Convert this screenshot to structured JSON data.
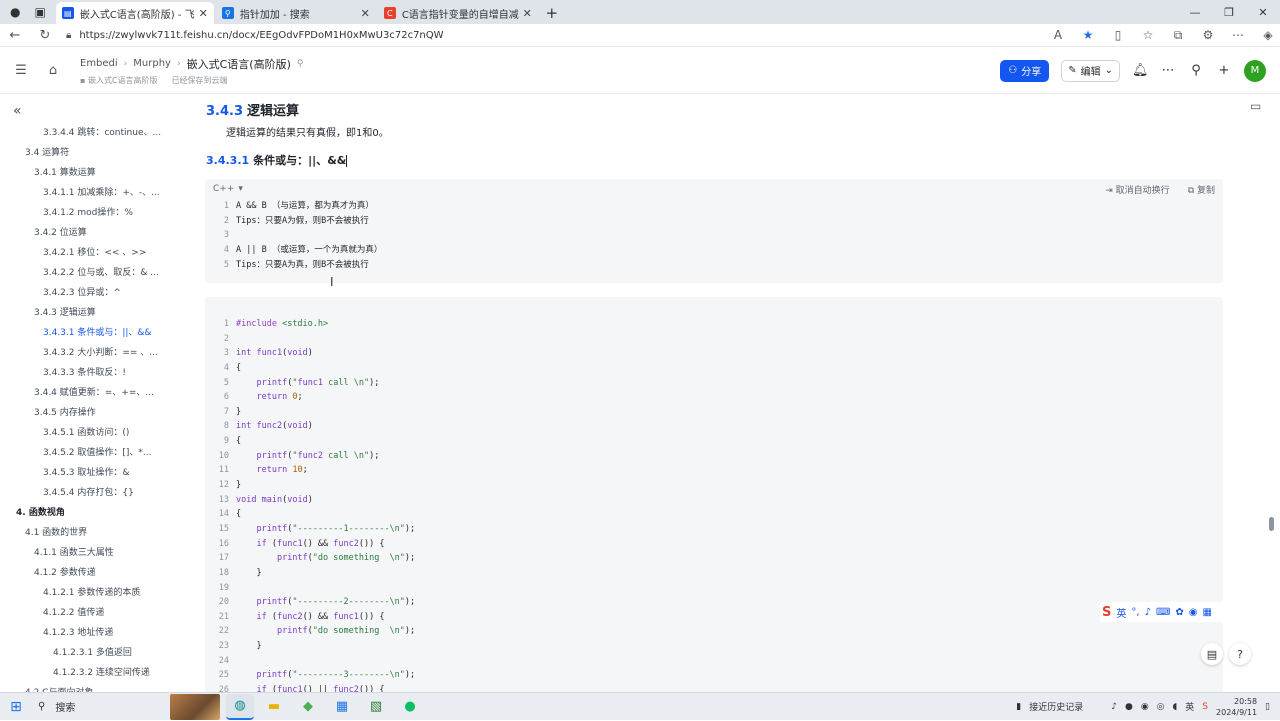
{
  "browser": {
    "tabs": [
      {
        "title": "嵌入式C语言(高阶版) - 飞书云文档",
        "active": true,
        "favicon_color": "#1456f0"
      },
      {
        "title": "指针加加 - 搜索",
        "active": false,
        "favicon_color": "#1a73e8"
      },
      {
        "title": "C语言指针变量的自增自减分析",
        "active": false,
        "favicon_color": "#e8412c"
      }
    ],
    "url": "https://zwylwvk711t.feishu.cn/docx/EEgOdvFPDoM1H0xMwU3c72c7nQW"
  },
  "header": {
    "breadcrumbs": [
      "Embedi",
      "Murphy",
      "嵌入式C语言(高阶版)"
    ],
    "sub_location": "嵌入式C语言高阶版",
    "save_status": "已经保存到云端",
    "share_label": "分享",
    "edit_label": "编辑",
    "avatar_letter": "M"
  },
  "outline": [
    {
      "label": "3.3.4.4 跳转：continue、...",
      "level": 4
    },
    {
      "label": "3.4 运算符",
      "level": 2
    },
    {
      "label": "3.4.1 算数运算",
      "level": 3
    },
    {
      "label": "3.4.1.1 加减乘除：+、-、...",
      "level": 4
    },
    {
      "label": "3.4.1.2 mod操作：%",
      "level": 4
    },
    {
      "label": "3.4.2 位运算",
      "level": 3
    },
    {
      "label": "3.4.2.1 移位：<< 、>>",
      "level": 4
    },
    {
      "label": "3.4.2.2 位与或、取反：& ...",
      "level": 4
    },
    {
      "label": "3.4.2.3 位异或：^",
      "level": 4
    },
    {
      "label": "3.4.3 逻辑运算",
      "level": 3
    },
    {
      "label": "3.4.3.1 条件或与：||、&&",
      "level": 4,
      "active": true
    },
    {
      "label": "3.4.3.2 大小判断：== 、...",
      "level": 4
    },
    {
      "label": "3.4.3.3 条件取反：!",
      "level": 4
    },
    {
      "label": "3.4.4 赋值更新：=、+=、...",
      "level": 3
    },
    {
      "label": "3.4.5 内存操作",
      "level": 3
    },
    {
      "label": "3.4.5.1 函数访问：()",
      "level": 4
    },
    {
      "label": "3.4.5.2 取值操作：[]、*...",
      "level": 4
    },
    {
      "label": "3.4.5.3 取址操作：&",
      "level": 4
    },
    {
      "label": "3.4.5.4 内存打包：{}",
      "level": 4
    },
    {
      "label": "4. 函数视角",
      "level": 1
    },
    {
      "label": "4.1 函数的世界",
      "level": 2
    },
    {
      "label": "4.1.1 函数三大属性",
      "level": 3
    },
    {
      "label": "4.1.2 参数传递",
      "level": 3
    },
    {
      "label": "4.1.2.1 参数传递的本质",
      "level": 4
    },
    {
      "label": "4.1.2.2 值传递",
      "level": 4
    },
    {
      "label": "4.1.2.3 地址传递",
      "level": 4
    },
    {
      "label": "4.1.2.3.1 多值返回",
      "level": 5
    },
    {
      "label": "4.1.2.3.2 连续空间传递",
      "level": 5
    },
    {
      "label": "4.2 C与面向对象",
      "level": 2
    }
  ],
  "doc": {
    "h3_num": "3.4.3",
    "h3_text": "逻辑运算",
    "paragraph": "逻辑运算的结果只有真假，即1和0。",
    "h4_num": "3.4.3.1",
    "h4_text": "条件或与：||、&&",
    "code_lang": "C++",
    "cancel_wrap": "取消自动换行",
    "copy": "复制",
    "code1": [
      "A && B （与运算，都为真才为真）",
      "Tips：只要A为假，则B不会被执行",
      "",
      "A || B （或运算，一个为真就为真）",
      "Tips：只要A为真，则B不会被执行"
    ],
    "code2": [
      "#include <stdio.h>",
      "",
      "int func1(void)",
      "{",
      "    printf(\"func1 call \\n\");",
      "    return 0;",
      "}",
      "int func2(void)",
      "{",
      "    printf(\"func2 call \\n\");",
      "    return 10;",
      "}",
      "void main(void)",
      "{",
      "    printf(\"---------1--------\\n\");",
      "    if (func1() && func2()) {",
      "        printf(\"do something  \\n\");",
      "    }",
      "",
      "    printf(\"---------2--------\\n\");",
      "    if (func2() && func1()) {",
      "        printf(\"do something  \\n\");",
      "    }",
      "",
      "    printf(\"---------3--------\\n\");",
      "    if (func1() || func2()) {"
    ]
  },
  "ime": {
    "logo": "S",
    "lang": "英"
  },
  "taskbar": {
    "search_label": "搜索",
    "history_label": "接近历史记录",
    "ime_lang": "英",
    "time": "20:58",
    "date": "2024/9/11"
  }
}
